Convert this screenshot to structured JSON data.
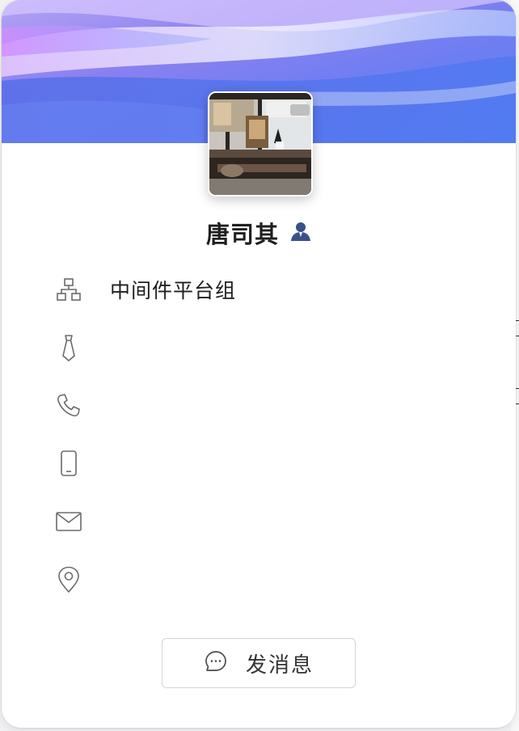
{
  "profile": {
    "name": "唐司其",
    "badge_icon": "user-badge-icon",
    "accent_color": "#3a5188"
  },
  "details": [
    {
      "icon": "org-chart-icon",
      "value": "中间件平台组"
    },
    {
      "icon": "tie-icon",
      "value": ""
    },
    {
      "icon": "phone-icon",
      "value": ""
    },
    {
      "icon": "mobile-icon",
      "value": ""
    },
    {
      "icon": "mail-icon",
      "value": ""
    },
    {
      "icon": "location-icon",
      "value": ""
    }
  ],
  "actions": {
    "send_message_label": "发消息",
    "send_message_icon": "chat-bubble-icon"
  }
}
